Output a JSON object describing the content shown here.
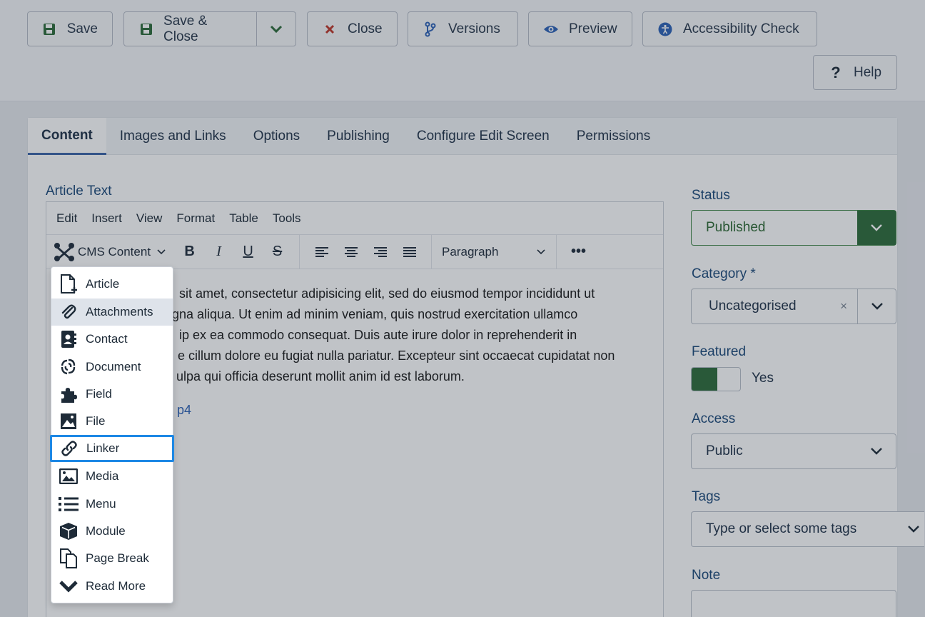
{
  "toolbar": {
    "save": "Save",
    "save_close": "Save & Close",
    "close": "Close",
    "versions": "Versions",
    "preview": "Preview",
    "accessibility": "Accessibility Check",
    "help": "Help"
  },
  "tabs": [
    "Content",
    "Images and Links",
    "Options",
    "Publishing",
    "Configure Edit Screen",
    "Permissions"
  ],
  "editor": {
    "label": "Article Text",
    "menu": [
      "Edit",
      "Insert",
      "View",
      "Format",
      "Table",
      "Tools"
    ],
    "cms_content": "CMS Content",
    "paragraph": "Paragraph",
    "text_lines": [
      "sit amet, consectetur adipisicing elit, sed do eiusmod tempor incididunt ut",
      "agna aliqua. Ut enim ad minim veniam, quis nostrud exercitation ullamco",
      "ip ex ea commodo consequat. Duis aute irure dolor in reprehenderit in",
      "e cillum dolore eu fugiat nulla pariatur. Excepteur sint occaecat cupidatat non",
      "ulpa qui officia deserunt mollit anim id est laborum."
    ],
    "link_fragment": "p4"
  },
  "dropdown": {
    "items": [
      "Article",
      "Attachments",
      "Contact",
      "Document",
      "Field",
      "File",
      "Linker",
      "Media",
      "Menu",
      "Module",
      "Page Break",
      "Read More"
    ],
    "hovered": "Attachments",
    "focused": "Linker"
  },
  "sidebar": {
    "status_label": "Status",
    "status_value": "Published",
    "category_label": "Category *",
    "category_value": "Uncategorised",
    "featured_label": "Featured",
    "featured_value": "Yes",
    "access_label": "Access",
    "access_value": "Public",
    "tags_label": "Tags",
    "tags_placeholder": "Type or select some tags",
    "note_label": "Note"
  },
  "colors": {
    "accent": "#3d66a8",
    "success": "#2f6c3b",
    "focus": "#1e88e5",
    "danger": "#c0392b"
  }
}
